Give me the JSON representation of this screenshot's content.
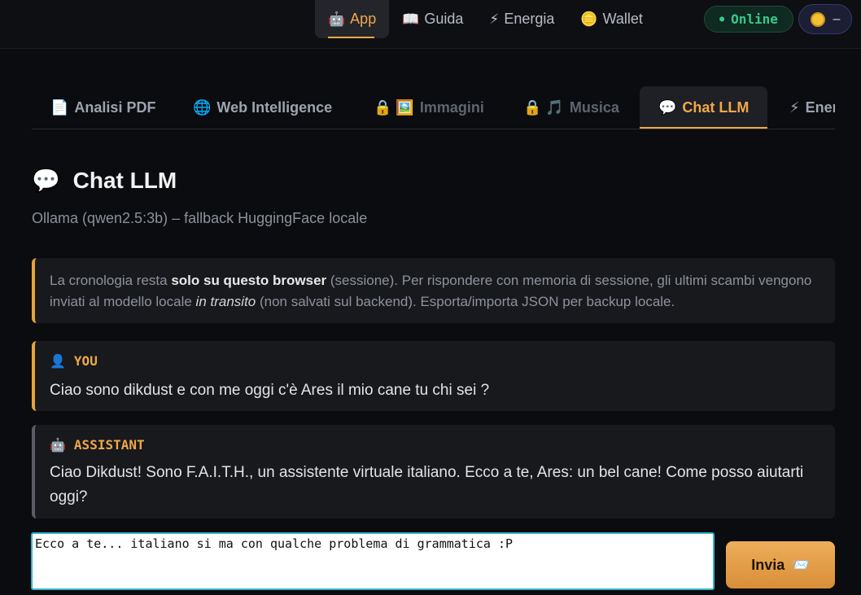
{
  "topnav": {
    "items": [
      {
        "icon": "🤖",
        "label": "App",
        "active": true
      },
      {
        "icon": "📖",
        "label": "Guida"
      },
      {
        "icon": "⚡",
        "label": "Energia"
      },
      {
        "icon": "🪙",
        "label": "Wallet"
      }
    ]
  },
  "status": {
    "label": "Online",
    "color": "#39c98b"
  },
  "wallet": {
    "balance": "–"
  },
  "tabs": [
    {
      "icon": "📄",
      "label": "Analisi PDF"
    },
    {
      "icon": "🌐",
      "label": "Web Intelligence"
    },
    {
      "icon": "🔒 🖼️",
      "label": "Immagini",
      "locked": true
    },
    {
      "icon": "🔒 🎵",
      "label": "Musica",
      "locked": true
    },
    {
      "icon": "💬",
      "label": "Chat LLM",
      "active": true
    },
    {
      "icon": "⚡",
      "label": "Energia"
    }
  ],
  "page": {
    "icon": "💬",
    "title": "Chat LLM",
    "subtitle": "Ollama (qwen2.5:3b) – fallback HuggingFace locale"
  },
  "note": {
    "part1": "La cronologia resta ",
    "bold": "solo su questo browser",
    "part2": " (sessione). Per rispondere con memoria di sessione, gli ultimi scambi vengono inviati al modello locale ",
    "italic": "in transito",
    "part3": " (non salvati sul backend). Esporta/importa JSON per backup locale."
  },
  "messages": [
    {
      "role_icon": "👤",
      "role": "YOU",
      "text": "Ciao sono dikdust e con me oggi c'è Ares il mio cane tu chi sei ?"
    },
    {
      "role_icon": "🤖",
      "role": "ASSISTANT",
      "text": "Ciao Dikdust! Sono F.A.I.T.H., un assistente virtuale italiano. Ecco a te, Ares: un bel cane! Come posso aiutarti oggi?"
    }
  ],
  "composer": {
    "value": "Ecco a te... italiano si ma con qualche problema di grammatica :P",
    "send_label": "Invia",
    "send_icon": "📨"
  },
  "colors": {
    "accent": "#f0a848",
    "online": "#39c98b",
    "input_focus": "#35b4c8"
  }
}
